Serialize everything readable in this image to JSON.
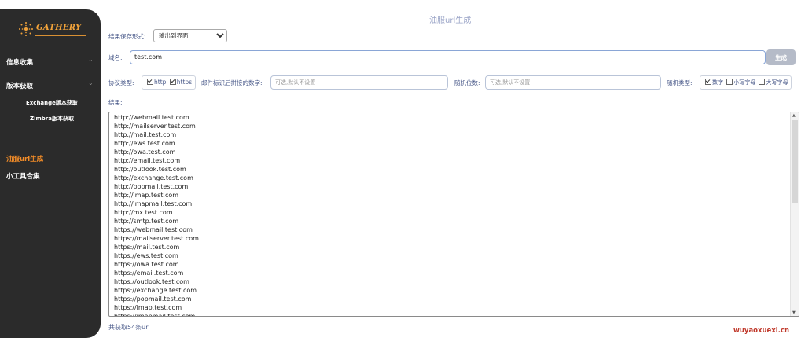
{
  "sidebar": {
    "logo_text": "GATHERY",
    "items": [
      {
        "label": "信息收集",
        "chevron": "⌄"
      },
      {
        "label": "版本获取",
        "chevron": "⌄"
      },
      {
        "label": "Exchange版本获取"
      },
      {
        "label": "Zimbra版本获取"
      },
      {
        "label": "油服url生成"
      },
      {
        "label": "小工具合集"
      }
    ],
    "active_color": "#f28c28"
  },
  "main": {
    "title": "油服url生成",
    "save_format": {
      "label": "结果保存形式:",
      "value": "输出到界面"
    },
    "domain": {
      "label": "域名:",
      "value": "test.com"
    },
    "generate_label": "生成",
    "protocol": {
      "label": "协议类型:",
      "options": [
        {
          "label": "http",
          "checked": true
        },
        {
          "label": "https",
          "checked": true
        }
      ]
    },
    "mail_suffix": {
      "label": "邮件标识后拼接的数字:",
      "placeholder": "可选,默认不设置"
    },
    "random_digits": {
      "label": "随机位数:",
      "placeholder": "可选,默认不设置"
    },
    "random_type": {
      "label": "随机类型:",
      "options": [
        {
          "label": "数字",
          "checked": true
        },
        {
          "label": "小写字母",
          "checked": false
        },
        {
          "label": "大写字母",
          "checked": false
        }
      ]
    },
    "results_label": "结果:",
    "results": [
      "http://webmail.test.com",
      "http://mailserver.test.com",
      "http://mail.test.com",
      "http://ews.test.com",
      "http://owa.test.com",
      "http://email.test.com",
      "http://outlook.test.com",
      "http://exchange.test.com",
      "http://popmail.test.com",
      "http://imap.test.com",
      "http://imapmail.test.com",
      "http://mx.test.com",
      "http://smtp.test.com",
      "https://webmail.test.com",
      "https://mailserver.test.com",
      "https://mail.test.com",
      "https://ews.test.com",
      "https://owa.test.com",
      "https://email.test.com",
      "https://outlook.test.com",
      "https://exchange.test.com",
      "https://popmail.test.com",
      "https://imap.test.com",
      "https://imapmail.test.com"
    ],
    "count_text": "共获取54条url"
  },
  "watermark": "wuyaoxuexi.cn"
}
